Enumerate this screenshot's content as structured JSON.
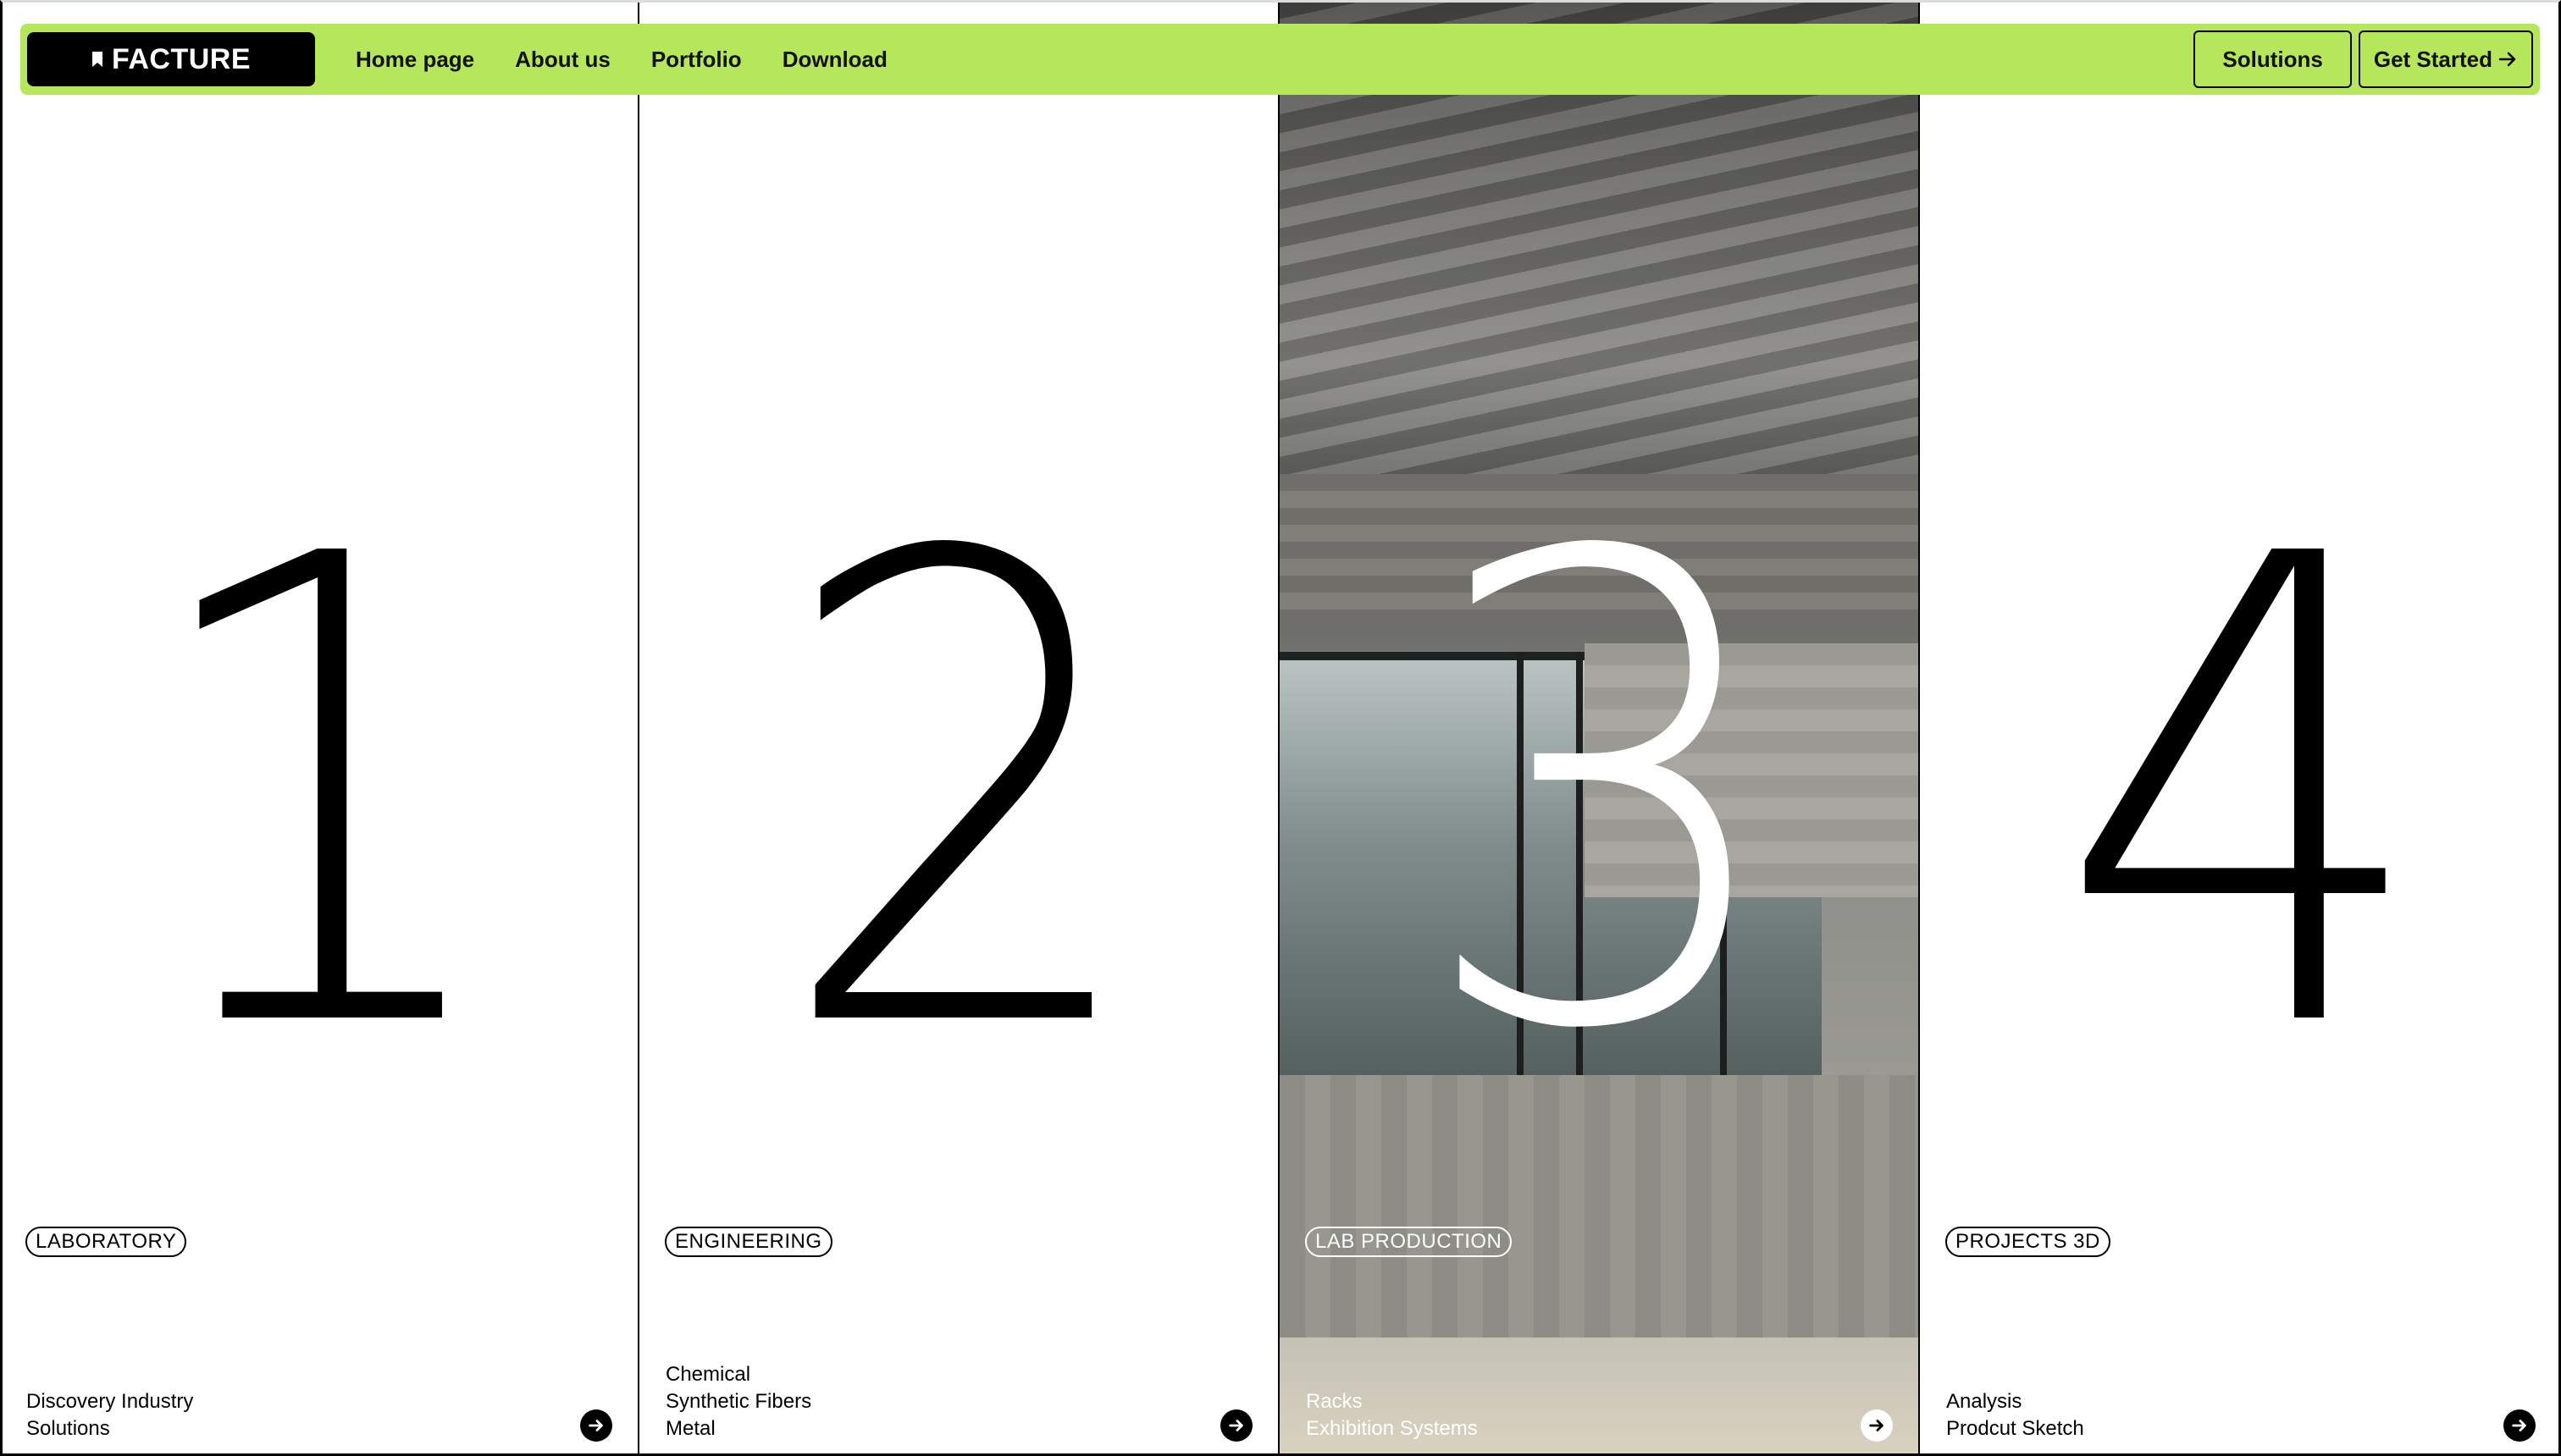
{
  "navbar": {
    "logo": "FACTURE",
    "links": [
      "Home page",
      "About us",
      "Portfolio",
      "Download"
    ],
    "solutions_label": "Solutions",
    "get_started_label": "Get Started"
  },
  "cards": [
    {
      "number": "1",
      "tag": "LABORATORY",
      "lines": [
        "Discovery Industry",
        "Solutions"
      ]
    },
    {
      "number": "2",
      "tag": "ENGINEERING",
      "lines": [
        "Chemical",
        "Synthetic Fibers",
        "Metal"
      ]
    },
    {
      "number": "3",
      "tag": "LAB PRODUCTION",
      "lines": [
        "Racks",
        "Exhibition Systems"
      ]
    },
    {
      "number": "4",
      "tag": "PROJECTS 3D",
      "lines": [
        "Analysis",
        "Prodcut Sketch"
      ]
    }
  ],
  "colors": {
    "accent": "#b5e65b",
    "dark": "#000000",
    "light": "#ffffff"
  },
  "icons": {
    "logo": "bookmark-icon",
    "card_action": "arrow-right-icon",
    "cta": "arrow-right-icon"
  }
}
